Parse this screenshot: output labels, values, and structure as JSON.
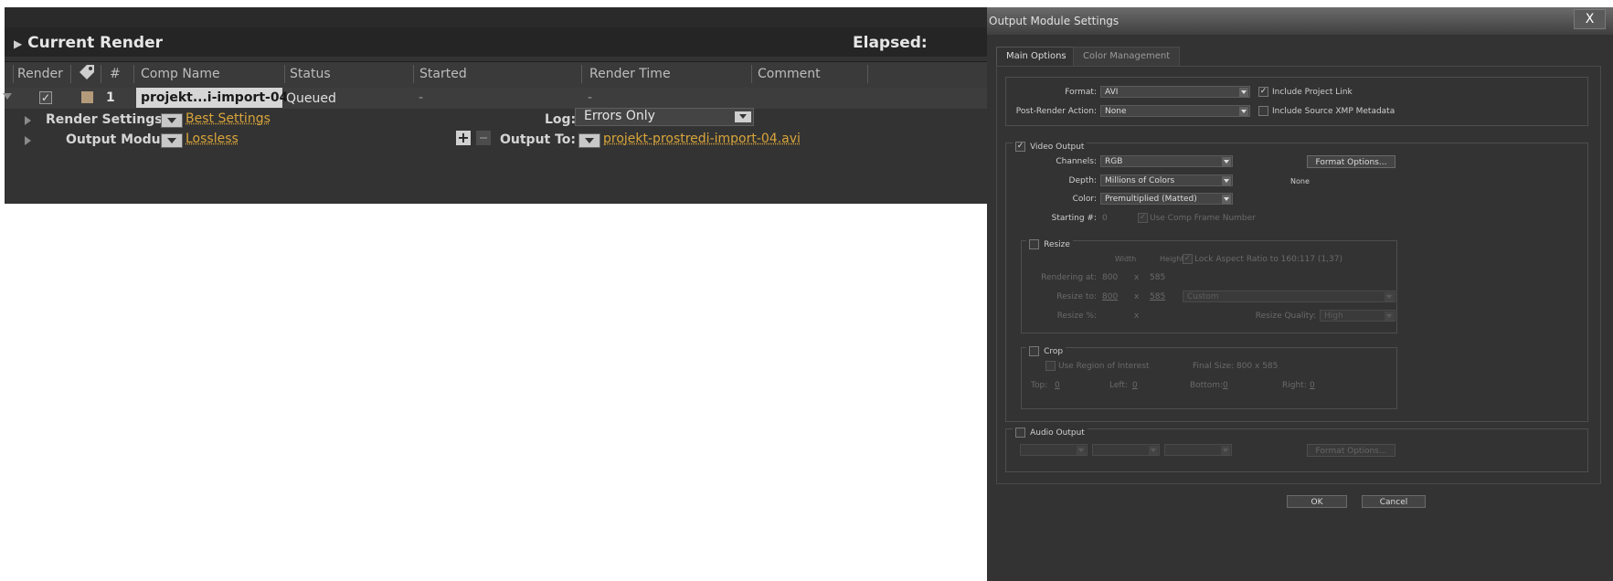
{
  "render_queue": {
    "title": "Current Render",
    "elapsed_label": "Elapsed:",
    "columns": {
      "render": "Render",
      "num": "#",
      "comp_name": "Comp Name",
      "status": "Status",
      "started": "Started",
      "render_time": "Render Time",
      "comment": "Comment"
    },
    "item": {
      "number": "1",
      "comp_name": "projekt...i-import-04",
      "status": "Queued",
      "started": "-",
      "render_time": "-",
      "render_settings_label": "Render Settings:",
      "render_settings_value": "Best Settings",
      "log_label": "Log:",
      "log_value": "Errors Only",
      "output_module_label": "Output Module:",
      "output_module_value": "Lossless",
      "output_to_label": "Output To:",
      "output_to_value": "projekt-prostredi-import-04.avi"
    }
  },
  "dialog": {
    "title": "Output Module Settings",
    "close": "X",
    "tabs": [
      "Main Options",
      "Color Management"
    ],
    "format_label": "Format:",
    "format_value": "AVI",
    "include_project_link": "Include Project Link",
    "post_render_label": "Post-Render Action:",
    "post_render_value": "None",
    "include_xmp": "Include Source XMP Metadata",
    "video_output": "Video Output",
    "channels_label": "Channels:",
    "channels_value": "RGB",
    "format_options": "Format Options...",
    "depth_label": "Depth:",
    "depth_value": "Millions of Colors",
    "none_text": "None",
    "color_label": "Color:",
    "color_value": "Premultiplied (Matted)",
    "starting_label": "Starting #:",
    "starting_value": "0",
    "use_comp_frame": "Use Comp Frame Number",
    "resize": {
      "label": "Resize",
      "width": "Width",
      "height": "Height",
      "lock_aspect": "Lock Aspect Ratio to 160:117 (1,37)",
      "rendering_at": "Rendering at:",
      "rendering_w": "800",
      "x": "x",
      "rendering_h": "585",
      "resize_to": "Resize to:",
      "resize_w": "800",
      "resize_h": "585",
      "custom": "Custom",
      "resize_pct": "Resize %:",
      "resize_quality": "Resize Quality:",
      "quality_value": "High"
    },
    "crop": {
      "label": "Crop",
      "use_roi": "Use Region of Interest",
      "final_size": "Final Size: 800 x 585",
      "top": "Top:",
      "top_v": "0",
      "left": "Left:",
      "left_v": "0",
      "bottom": "Bottom:",
      "bottom_v": "0",
      "right": "Right:",
      "right_v": "0"
    },
    "audio_output": "Audio Output",
    "audio_format_options": "Format Options...",
    "ok": "OK",
    "cancel": "Cancel"
  }
}
